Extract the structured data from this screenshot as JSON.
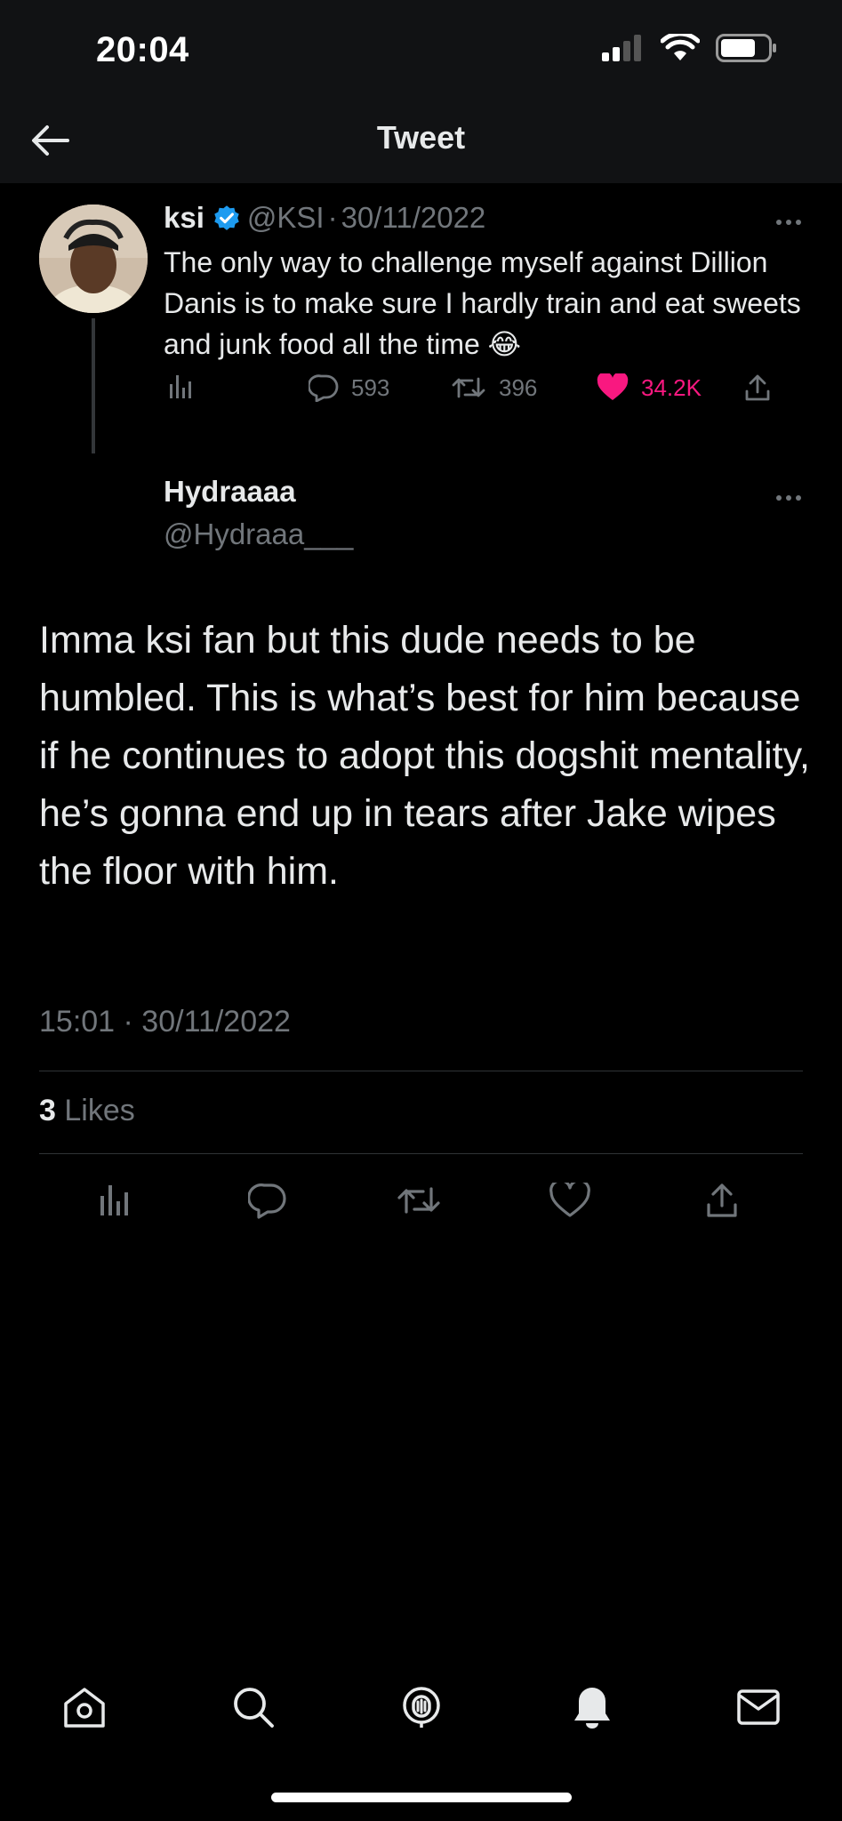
{
  "status_bar": {
    "time": "20:04"
  },
  "header": {
    "title": "Tweet"
  },
  "parent_tweet": {
    "name": "ksi",
    "handle": "@KSI",
    "separator": "·",
    "date": "30/11/2022",
    "text": "The only way to challenge myself against Dillion Danis is to make sure I hardly train and eat sweets and junk food all the time",
    "emoji": "😂",
    "replies": "593",
    "retweets": "396",
    "likes": "34.2K",
    "liked": true,
    "like_color": "#f91880",
    "verified_color": "#1d9bf0"
  },
  "reply_tweet": {
    "name": "Hydraaaa",
    "handle": "@Hydraaa___",
    "text": "Imma ksi fan but this dude needs to be humbled. This is what’s best for him because if he continues to adopt this dogshit mentality, he’s gonna end up in tears after Jake wipes the floor with him.",
    "timestamp": "15:01 · 30/11/2022",
    "likes_count": "3",
    "likes_label": "Likes"
  },
  "tabs": [
    "home-icon",
    "search-icon",
    "spaces-icon",
    "notifications-icon",
    "messages-icon"
  ]
}
